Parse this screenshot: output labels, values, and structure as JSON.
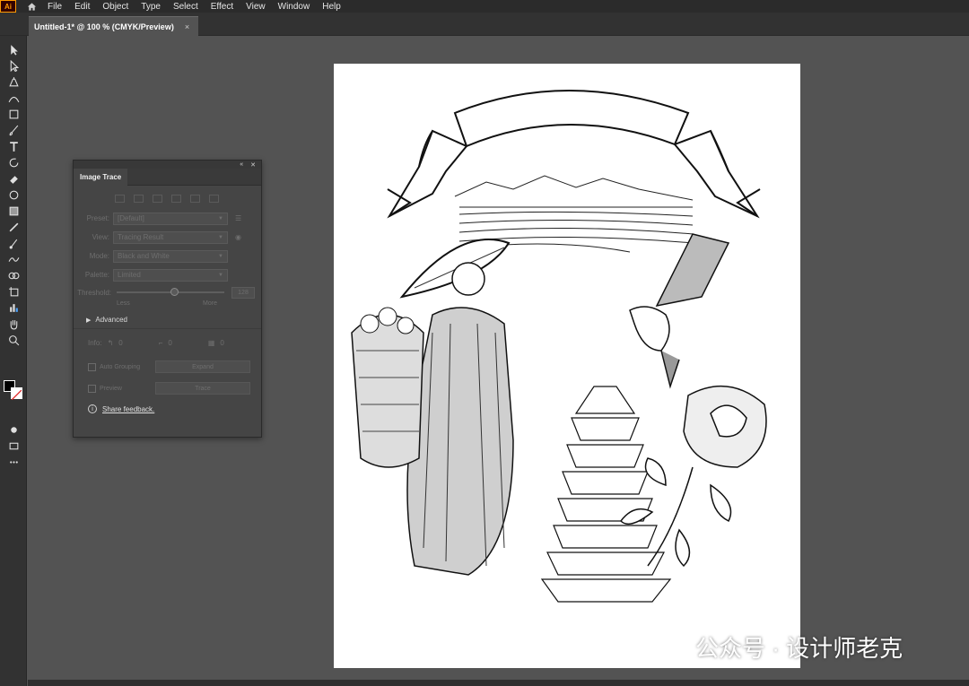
{
  "app": {
    "logo": "Ai"
  },
  "menu": [
    "File",
    "Edit",
    "Object",
    "Type",
    "Select",
    "Effect",
    "View",
    "Window",
    "Help"
  ],
  "document_tab": {
    "title": "Untitled-1* @ 100 % (CMYK/Preview)",
    "close": "×"
  },
  "tools": [
    "selection-tool-icon",
    "direct-selection-tool-icon",
    "pen-tool-icon",
    "curvature-tool-icon",
    "rectangle-tool-icon",
    "paintbrush-tool-icon",
    "type-tool-icon",
    "rotate-tool-icon",
    "eraser-tool-icon",
    "warp-tool-icon",
    "gradient-tool-icon",
    "eyedropper-tool-icon",
    "blend-tool-icon",
    "width-tool-icon",
    "shape-builder-tool-icon",
    "artboard-tool-icon",
    "graph-tool-icon",
    "hand-tool-icon"
  ],
  "image_trace": {
    "tab_label": "Image Trace",
    "preset_label": "Preset:",
    "preset_value": "[Default]",
    "view_label": "View:",
    "view_value": "Tracing Result",
    "mode_label": "Mode:",
    "mode_value": "Black and White",
    "palette_label": "Palette:",
    "palette_value": "Limited",
    "threshold_label": "Threshold:",
    "threshold_value": "128",
    "threshold_fraction": 0.5,
    "less_label": "Less",
    "more_label": "More",
    "advanced_label": "Advanced",
    "info_label": "Info:",
    "paths_count": "0",
    "anchors_count": "0",
    "colors_count": "0",
    "auto_grouping_label": "Auto Grouping",
    "expand_label": "Expand",
    "preview_label": "Preview",
    "trace_label": "Trace",
    "feedback_label": "Share feedback."
  },
  "watermark": {
    "text": "公众号 · 设计师老克"
  },
  "colors": {
    "menubar": "#2b2b2b",
    "canvas": "#535353",
    "panel": "#454545",
    "logo": "#ff9a00"
  }
}
